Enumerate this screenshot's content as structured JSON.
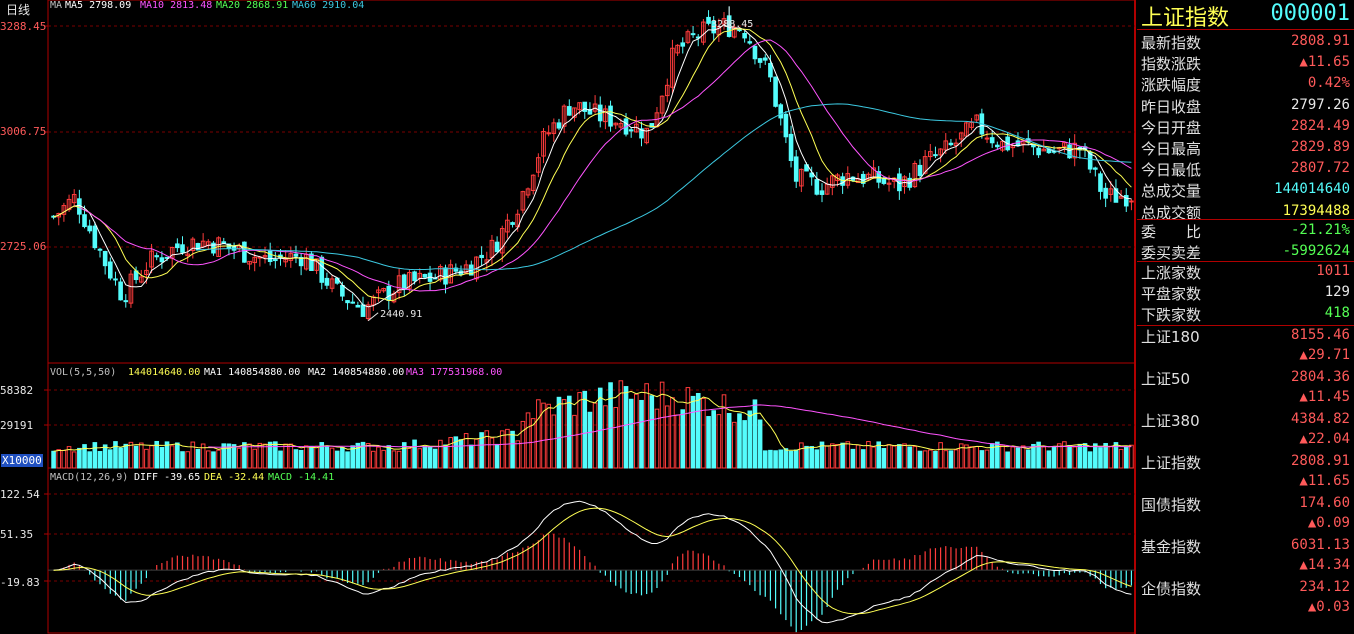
{
  "colors": {
    "up": "#ff3c3c",
    "down": "#54fcfc",
    "ma5": "#ffffff",
    "ma10": "#ffff54",
    "ma20": "#ff54ff",
    "ma60": "#54ff54",
    "ma_long": "#3cc8e0",
    "grid": "#7a0000",
    "label_red": "#ff5a5a",
    "label_white": "#e8e8e8",
    "label_yellow": "#ffff54",
    "label_cyan": "#54fcfc",
    "label_green": "#54ff54"
  },
  "header": {
    "period_label": "日线",
    "ma_legend": [
      {
        "text": "MA5 2798.09",
        "color": "#ffffff"
      },
      {
        "text": "MA10 2813.48",
        "color": "#ff54ff"
      },
      {
        "text": "MA20 2868.91",
        "color": "#54ff54"
      },
      {
        "text": "MA60 2910.04",
        "color": "#3cc8e0"
      }
    ],
    "ma_prefix": "MA"
  },
  "chart_data": [
    {
      "type": "candlestick",
      "name": "price",
      "y_ticks": [
        "3288.45",
        "3006.75",
        "2725.06"
      ],
      "ylim": [
        2400,
        3300
      ],
      "annotations": [
        {
          "text": "3288.45"
        },
        {
          "text": "2440.91"
        }
      ],
      "x_count": 210
    },
    {
      "type": "bar",
      "name": "volume",
      "legend": [
        {
          "text": "VOL(5,5,50)",
          "color": "#c0c0c0"
        },
        {
          "text": "144014640.00",
          "color": "#ffff54"
        },
        {
          "text": "MA1 140854880.00",
          "color": "#ffffff"
        },
        {
          "text": "MA2 140854880.00",
          "color": "#ffffff"
        },
        {
          "text": "MA3 177531968.00",
          "color": "#ff54ff"
        }
      ],
      "y_ticks": [
        "58382",
        "29191"
      ],
      "unit_label": "X10000",
      "ylim": [
        0,
        62000
      ]
    },
    {
      "type": "bar",
      "name": "macd",
      "legend": [
        {
          "text": "MACD(12,26,9)",
          "color": "#c0c0c0"
        },
        {
          "text": "DIFF -39.65",
          "color": "#ffffff"
        },
        {
          "text": "DEA -32.44",
          "color": "#ffff54"
        },
        {
          "text": "MACD -14.41",
          "color": "#54ff54"
        }
      ],
      "y_ticks": [
        "122.54",
        "51.35",
        "-19.83"
      ],
      "ylim": [
        -100,
        135
      ]
    }
  ],
  "panel": {
    "title": "上证指数",
    "code": "000001",
    "quote": [
      {
        "label": "最新指数",
        "value": "2808.91",
        "color": "#ff5a5a"
      },
      {
        "label": "指数涨跌",
        "value": "▲11.65",
        "color": "#ff5a5a"
      },
      {
        "label": "涨跌幅度",
        "value": "0.42%",
        "color": "#ff5a5a"
      },
      {
        "label": "昨日收盘",
        "value": "2797.26",
        "color": "#e8e8e8"
      },
      {
        "label": "今日开盘",
        "value": "2824.49",
        "color": "#ff5a5a"
      },
      {
        "label": "今日最高",
        "value": "2829.89",
        "color": "#ff5a5a"
      },
      {
        "label": "今日最低",
        "value": "2807.72",
        "color": "#ff5a5a"
      },
      {
        "label": "总成交量",
        "value": "144014640",
        "color": "#54fcfc"
      },
      {
        "label": "总成交额",
        "value": "17394488",
        "color": "#ffff54"
      }
    ],
    "ratio": [
      {
        "label": "委　　比",
        "value": "-21.21%",
        "color": "#54ff54"
      },
      {
        "label": "委买卖差",
        "value": "-5992624",
        "color": "#54ff54"
      }
    ],
    "breadth": [
      {
        "label": "上涨家数",
        "value": "1011",
        "color": "#ff5a5a"
      },
      {
        "label": "平盘家数",
        "value": "129",
        "color": "#e8e8e8"
      },
      {
        "label": "下跌家数",
        "value": "418",
        "color": "#54ff54"
      }
    ],
    "indices": [
      {
        "label": "上证180",
        "value": "8155.46",
        "change": "▲29.71"
      },
      {
        "label": "上证50",
        "value": "2804.36",
        "change": "▲11.45"
      },
      {
        "label": "上证380",
        "value": "4384.82",
        "change": "▲22.04"
      },
      {
        "label": "上证指数",
        "value": "2808.91",
        "change": "▲11.65"
      },
      {
        "label": "国债指数",
        "value": "174.60",
        "change": "▲0.09"
      },
      {
        "label": "基金指数",
        "value": "6031.13",
        "change": "▲14.34"
      },
      {
        "label": "企债指数",
        "value": "234.12",
        "change": "▲0.03"
      }
    ]
  }
}
